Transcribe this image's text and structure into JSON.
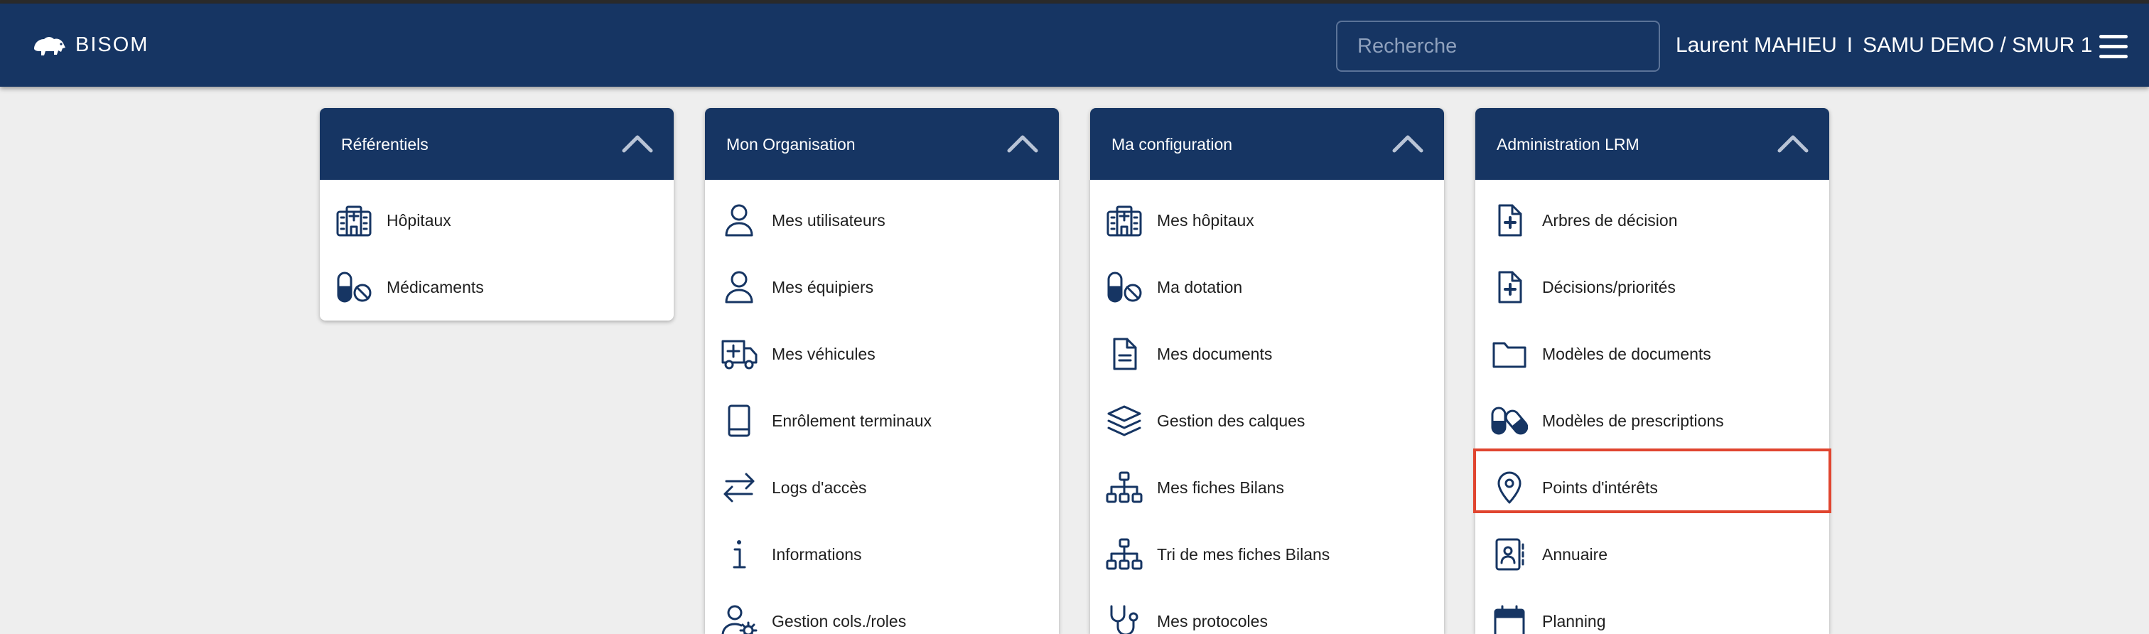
{
  "header": {
    "brand": "BISOM",
    "search_placeholder": "Recherche",
    "user_name": "Laurent MAHIEU",
    "separator": "I",
    "organization": "SAMU DEMO / SMUR 1"
  },
  "colors": {
    "navy": "#163563",
    "highlight": "#e0452f",
    "background": "#eeeeee"
  },
  "cards": [
    {
      "title": "Référentiels",
      "items": [
        {
          "label": "Hôpitaux",
          "icon": "hospital-icon"
        },
        {
          "label": "Médicaments",
          "icon": "pills-icon"
        }
      ]
    },
    {
      "title": "Mon Organisation",
      "items": [
        {
          "label": "Mes utilisateurs",
          "icon": "user-icon"
        },
        {
          "label": "Mes équipiers",
          "icon": "user-icon"
        },
        {
          "label": "Mes véhicules",
          "icon": "ambulance-icon"
        },
        {
          "label": "Enrôlement terminaux",
          "icon": "tablet-icon"
        },
        {
          "label": "Logs d'accès",
          "icon": "arrows-exchange-icon"
        },
        {
          "label": "Informations",
          "icon": "info-icon"
        },
        {
          "label": "Gestion cols./roles",
          "icon": "user-gear-icon"
        }
      ]
    },
    {
      "title": "Ma configuration",
      "items": [
        {
          "label": "Mes hôpitaux",
          "icon": "hospital-icon"
        },
        {
          "label": "Ma dotation",
          "icon": "pills-icon"
        },
        {
          "label": "Mes documents",
          "icon": "document-icon"
        },
        {
          "label": "Gestion des calques",
          "icon": "layers-icon"
        },
        {
          "label": "Mes fiches Bilans",
          "icon": "sitemap-icon"
        },
        {
          "label": "Tri de mes fiches Bilans",
          "icon": "sitemap-icon"
        },
        {
          "label": "Mes protocoles",
          "icon": "stethoscope-icon"
        }
      ]
    },
    {
      "title": "Administration LRM",
      "items": [
        {
          "label": "Arbres de décision",
          "icon": "file-medical-icon"
        },
        {
          "label": "Décisions/priorités",
          "icon": "file-medical-icon"
        },
        {
          "label": "Modèles de documents",
          "icon": "folder-icon"
        },
        {
          "label": "Modèles de prescriptions",
          "icon": "capsules-icon"
        },
        {
          "label": "Points d'intérêts",
          "icon": "map-pin-icon"
        },
        {
          "label": "Annuaire",
          "icon": "address-book-icon"
        },
        {
          "label": "Planning",
          "icon": "calendar-icon"
        }
      ]
    }
  ]
}
